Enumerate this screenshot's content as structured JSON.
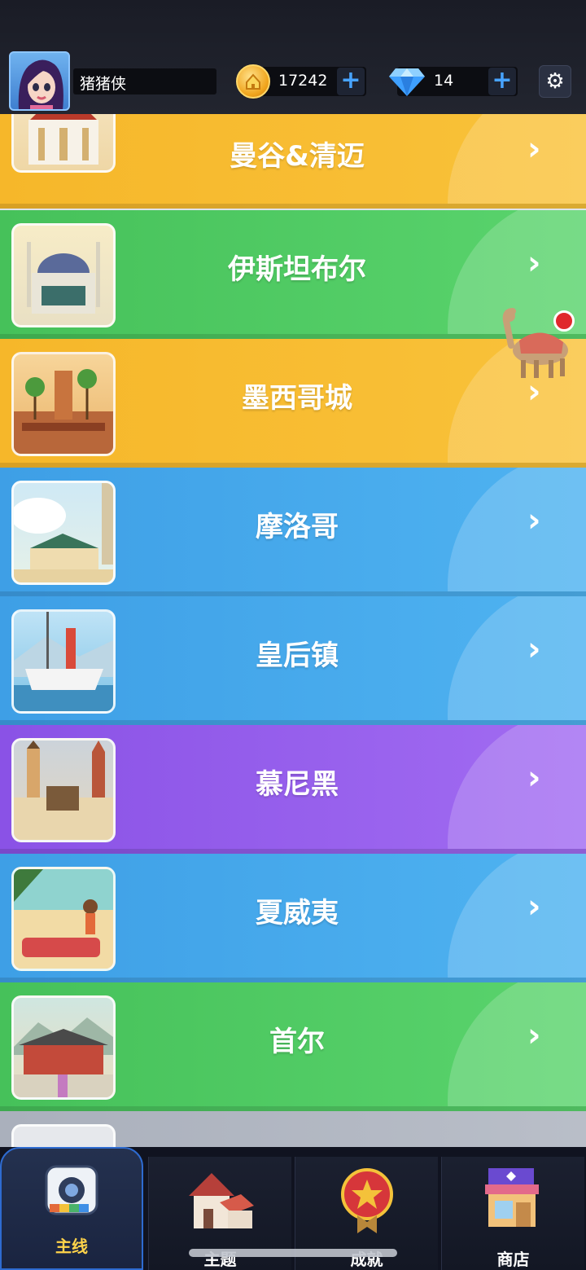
{
  "header": {
    "username": "猪猪侠",
    "coins": "17242",
    "gems": "14",
    "coin_plus": "+",
    "gem_plus": "+"
  },
  "levels": [
    {
      "title": "曼谷&清迈",
      "color": "yellow"
    },
    {
      "title": "伊斯坦布尔",
      "color": "green"
    },
    {
      "title": "墨西哥城",
      "color": "yellow"
    },
    {
      "title": "摩洛哥",
      "color": "blue"
    },
    {
      "title": "皇后镇",
      "color": "blue"
    },
    {
      "title": "慕尼黑",
      "color": "purple"
    },
    {
      "title": "夏威夷",
      "color": "blue"
    },
    {
      "title": "首尔",
      "color": "green"
    }
  ],
  "chevron": "›",
  "nav": {
    "items": [
      {
        "label": "主线",
        "icon": "camera-icon",
        "active": true
      },
      {
        "label": "主题",
        "icon": "house-icon",
        "active": false
      },
      {
        "label": "成就",
        "icon": "medal-icon",
        "active": false
      },
      {
        "label": "商店",
        "icon": "shop-icon",
        "active": false
      }
    ]
  },
  "colors": {
    "yellow": "#f6b72a",
    "green": "#46c15a",
    "blue": "#3e9fe6",
    "purple": "#8a52e6",
    "accent": "#47a3ff",
    "nav_active_label": "#ffd34a"
  }
}
